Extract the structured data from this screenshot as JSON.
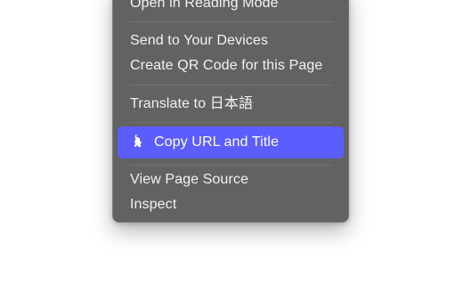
{
  "context_menu": {
    "items": [
      {
        "label": "Open in Reading Mode"
      },
      {
        "label": "Send to Your Devices"
      },
      {
        "label": "Create QR Code for this Page"
      },
      {
        "label": "Translate to 日本語"
      },
      {
        "label": "Copy URL and Title",
        "icon": "extension-icon",
        "highlighted": true
      },
      {
        "label": "View Page Source"
      },
      {
        "label": "Inspect"
      }
    ]
  },
  "colors": {
    "menu_background": "#626262",
    "highlight": "#5b5dfc",
    "text": "#f2f2f2"
  }
}
